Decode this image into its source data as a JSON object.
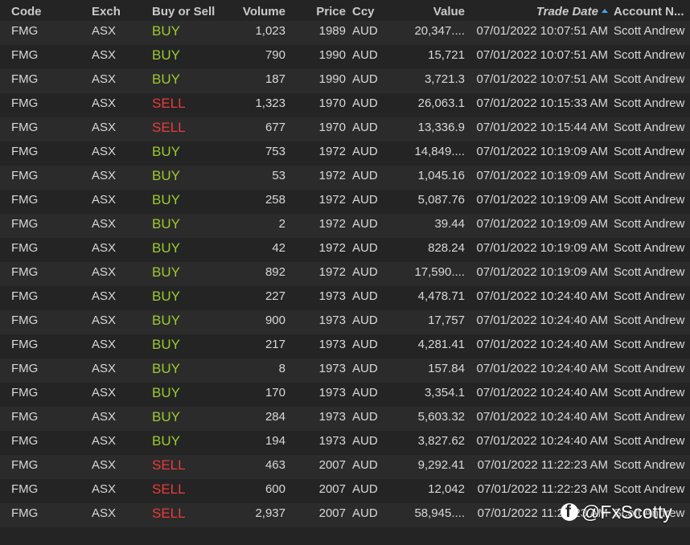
{
  "columns": {
    "code": "Code",
    "exch": "Exch",
    "side": "Buy or Sell",
    "volume": "Volume",
    "price": "Price",
    "ccy": "Ccy",
    "value": "Value",
    "trade_date": "Trade Date",
    "account": "Account N..."
  },
  "sort": {
    "column": "trade_date",
    "direction": "ascending"
  },
  "colors": {
    "buy": "#9ccc2e",
    "sell": "#ea3b3b",
    "sort_arrow": "#4aa3e8"
  },
  "rows": [
    {
      "code": "FMG",
      "exch": "ASX",
      "side": "BUY",
      "volume": "1,023",
      "price": "1989",
      "ccy": "AUD",
      "value": "20,347....",
      "trade_date": "07/01/2022 10:07:51 AM",
      "account": "Scott Andrew"
    },
    {
      "code": "FMG",
      "exch": "ASX",
      "side": "BUY",
      "volume": "790",
      "price": "1990",
      "ccy": "AUD",
      "value": "15,721",
      "trade_date": "07/01/2022 10:07:51 AM",
      "account": "Scott Andrew"
    },
    {
      "code": "FMG",
      "exch": "ASX",
      "side": "BUY",
      "volume": "187",
      "price": "1990",
      "ccy": "AUD",
      "value": "3,721.3",
      "trade_date": "07/01/2022 10:07:51 AM",
      "account": "Scott Andrew"
    },
    {
      "code": "FMG",
      "exch": "ASX",
      "side": "SELL",
      "volume": "1,323",
      "price": "1970",
      "ccy": "AUD",
      "value": "26,063.1",
      "trade_date": "07/01/2022 10:15:33 AM",
      "account": "Scott Andrew"
    },
    {
      "code": "FMG",
      "exch": "ASX",
      "side": "SELL",
      "volume": "677",
      "price": "1970",
      "ccy": "AUD",
      "value": "13,336.9",
      "trade_date": "07/01/2022 10:15:44 AM",
      "account": "Scott Andrew"
    },
    {
      "code": "FMG",
      "exch": "ASX",
      "side": "BUY",
      "volume": "753",
      "price": "1972",
      "ccy": "AUD",
      "value": "14,849....",
      "trade_date": "07/01/2022 10:19:09 AM",
      "account": "Scott Andrew"
    },
    {
      "code": "FMG",
      "exch": "ASX",
      "side": "BUY",
      "volume": "53",
      "price": "1972",
      "ccy": "AUD",
      "value": "1,045.16",
      "trade_date": "07/01/2022 10:19:09 AM",
      "account": "Scott Andrew"
    },
    {
      "code": "FMG",
      "exch": "ASX",
      "side": "BUY",
      "volume": "258",
      "price": "1972",
      "ccy": "AUD",
      "value": "5,087.76",
      "trade_date": "07/01/2022 10:19:09 AM",
      "account": "Scott Andrew"
    },
    {
      "code": "FMG",
      "exch": "ASX",
      "side": "BUY",
      "volume": "2",
      "price": "1972",
      "ccy": "AUD",
      "value": "39.44",
      "trade_date": "07/01/2022 10:19:09 AM",
      "account": "Scott Andrew"
    },
    {
      "code": "FMG",
      "exch": "ASX",
      "side": "BUY",
      "volume": "42",
      "price": "1972",
      "ccy": "AUD",
      "value": "828.24",
      "trade_date": "07/01/2022 10:19:09 AM",
      "account": "Scott Andrew"
    },
    {
      "code": "FMG",
      "exch": "ASX",
      "side": "BUY",
      "volume": "892",
      "price": "1972",
      "ccy": "AUD",
      "value": "17,590....",
      "trade_date": "07/01/2022 10:19:09 AM",
      "account": "Scott Andrew"
    },
    {
      "code": "FMG",
      "exch": "ASX",
      "side": "BUY",
      "volume": "227",
      "price": "1973",
      "ccy": "AUD",
      "value": "4,478.71",
      "trade_date": "07/01/2022 10:24:40 AM",
      "account": "Scott Andrew"
    },
    {
      "code": "FMG",
      "exch": "ASX",
      "side": "BUY",
      "volume": "900",
      "price": "1973",
      "ccy": "AUD",
      "value": "17,757",
      "trade_date": "07/01/2022 10:24:40 AM",
      "account": "Scott Andrew"
    },
    {
      "code": "FMG",
      "exch": "ASX",
      "side": "BUY",
      "volume": "217",
      "price": "1973",
      "ccy": "AUD",
      "value": "4,281.41",
      "trade_date": "07/01/2022 10:24:40 AM",
      "account": "Scott Andrew"
    },
    {
      "code": "FMG",
      "exch": "ASX",
      "side": "BUY",
      "volume": "8",
      "price": "1973",
      "ccy": "AUD",
      "value": "157.84",
      "trade_date": "07/01/2022 10:24:40 AM",
      "account": "Scott Andrew"
    },
    {
      "code": "FMG",
      "exch": "ASX",
      "side": "BUY",
      "volume": "170",
      "price": "1973",
      "ccy": "AUD",
      "value": "3,354.1",
      "trade_date": "07/01/2022 10:24:40 AM",
      "account": "Scott Andrew"
    },
    {
      "code": "FMG",
      "exch": "ASX",
      "side": "BUY",
      "volume": "284",
      "price": "1973",
      "ccy": "AUD",
      "value": "5,603.32",
      "trade_date": "07/01/2022 10:24:40 AM",
      "account": "Scott Andrew"
    },
    {
      "code": "FMG",
      "exch": "ASX",
      "side": "BUY",
      "volume": "194",
      "price": "1973",
      "ccy": "AUD",
      "value": "3,827.62",
      "trade_date": "07/01/2022 10:24:40 AM",
      "account": "Scott Andrew"
    },
    {
      "code": "FMG",
      "exch": "ASX",
      "side": "SELL",
      "volume": "463",
      "price": "2007",
      "ccy": "AUD",
      "value": "9,292.41",
      "trade_date": "07/01/2022 11:22:23 AM",
      "account": "Scott Andrew"
    },
    {
      "code": "FMG",
      "exch": "ASX",
      "side": "SELL",
      "volume": "600",
      "price": "2007",
      "ccy": "AUD",
      "value": "12,042",
      "trade_date": "07/01/2022 11:22:23 AM",
      "account": "Scott Andrew"
    },
    {
      "code": "FMG",
      "exch": "ASX",
      "side": "SELL",
      "volume": "2,937",
      "price": "2007",
      "ccy": "AUD",
      "value": "58,945....",
      "trade_date": "07/01/2022 11:22:23 AM",
      "account": "Scott Andrew"
    }
  ],
  "watermark": {
    "icon": "facebook-icon",
    "handle": "@FxScotty"
  }
}
